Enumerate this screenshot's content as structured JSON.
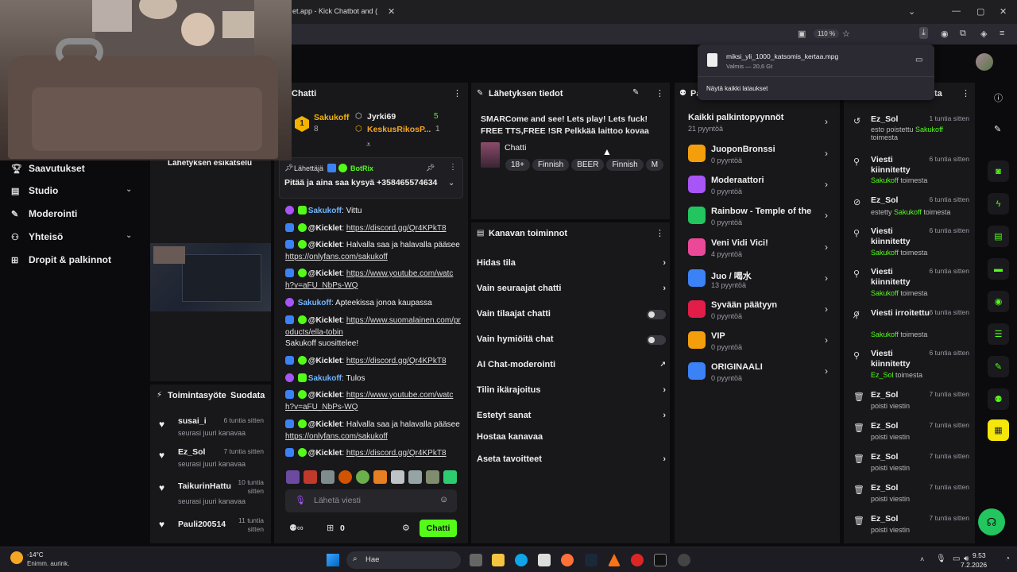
{
  "browser": {
    "tab_title": "et.app - Kick Chatbot and (",
    "zoom": "110 %",
    "download_file": "miksi_yli_1000_katsomis_kertaa.mpg",
    "download_status": "Valmis — 20,6 Gt",
    "download_show_all": "Näytä kaikki lataukset"
  },
  "sidebar": {
    "items": [
      {
        "label": "Saavutukset",
        "icon": "trophy-icon"
      },
      {
        "label": "Studio",
        "icon": "studio-icon"
      },
      {
        "label": "Moderointi",
        "icon": "wrench-icon"
      },
      {
        "label": "Yhteisö",
        "icon": "people-icon"
      },
      {
        "label": "Dropit & palkinnot",
        "icon": "gift-icon"
      }
    ],
    "preview_title": "Lähetyksen esikatselu"
  },
  "activity": {
    "title": "Toimintasyöte",
    "action": "Suodata",
    "rows": [
      {
        "name": "susai_i",
        "time": "6 tuntia sitten",
        "sub": "seurasi juuri kanavaa"
      },
      {
        "name": "Ez_Sol",
        "time": "7 tuntia sitten",
        "sub": "seurasi juuri kanavaa"
      },
      {
        "name": "TaikurinHattu",
        "time": "10 tuntia sitten",
        "sub": "seurasi juuri kanavaa"
      },
      {
        "name": "Pauli200514",
        "time": "11 tuntia sitten",
        "sub": "seurasi juuri kanavaa"
      }
    ]
  },
  "chat": {
    "title": "Chatti",
    "leader1_name": "Sakukoff",
    "leader1_count": "8",
    "leader2_name": "Jyrki69",
    "leader2_count": "5",
    "leader3_name": "KeskusRikosP...",
    "leader3_count": "1",
    "pinned_by_label": "Lähettäjä",
    "pinned_by": "BotRix",
    "pinned_text": "Pitää ja aina saa kysyä +358465574634",
    "messages": [
      {
        "user": "Sakukoff",
        "text": "Vittu"
      },
      {
        "user": "@Kicklet",
        "link": "https://discord.gg/Qr4KPkT8"
      },
      {
        "user": "@Kicklet",
        "text": "Halvalla saa ja halavalla pääsee",
        "link": "https://onlyfans.com/sakukoff"
      },
      {
        "user": "@Kicklet",
        "link": "https://www.youtube.com/watch?v=aFU_NbPs-WQ"
      },
      {
        "user": "Sakukoff",
        "text": "Apteekissa jonoa kaupassa"
      },
      {
        "user": "@Kicklet",
        "link": "https://www.suomalainen.com/products/ella-tobin",
        "text2": "Sakukoff suosittelee!"
      },
      {
        "user": "@Kicklet",
        "link": "https://discord.gg/Qr4KPkT8"
      },
      {
        "user": "Sakukoff",
        "text": "Tulos"
      },
      {
        "user": "@Kicklet",
        "link": "https://www.youtube.com/watch?v=aFU_NbPs-WQ"
      },
      {
        "user": "@Kicklet",
        "text": "Halvalla saa ja halavalla pääsee",
        "link": "https://onlyfans.com/sakukoff"
      },
      {
        "user": "@Kicklet",
        "link": "https://discord.gg/Qr4KPkT8"
      }
    ],
    "input_placeholder": "Lähetä viesti",
    "points": "0",
    "send_label": "Chatti"
  },
  "stream_info": {
    "title": "Lähetyksen tiedot",
    "stream_title": "SMARCome and see! Lets play! Lets fuck! FREE TTS,FREE !SR Pelkkää laittoo kovaa ajo...",
    "category": "Chatti",
    "tags": [
      "18+",
      "Finnish",
      "BEER",
      "Finnish",
      "M"
    ]
  },
  "channel_actions": {
    "title": "Kanavan toiminnot",
    "rows": [
      {
        "label": "Hidas tila",
        "kind": "chevron"
      },
      {
        "label": "Vain seuraajat chatti",
        "kind": "chevron"
      },
      {
        "label": "Vain tilaajat chatti",
        "kind": "toggle"
      },
      {
        "label": "Vain hymiöitä chat",
        "kind": "toggle"
      },
      {
        "label": "AI Chat-moderointi",
        "kind": "external"
      },
      {
        "label": "Tilin ikärajoitus",
        "kind": "chevron"
      },
      {
        "label": "Estetyt sanat",
        "kind": "chevron"
      },
      {
        "label": "Hostaa kanavaa",
        "kind": "none"
      },
      {
        "label": "Aseta tavoitteet",
        "kind": "chevron"
      }
    ]
  },
  "rewards": {
    "title": "Pa",
    "all_label": "Kaikki palkintopyynnöt",
    "all_count": "21 pyyntöä",
    "items": [
      {
        "name": "JuoponBronssi",
        "count": "0 pyyntöä",
        "color": "#f59e0b"
      },
      {
        "name": "Moderaattori",
        "count": "0 pyyntöä",
        "color": "#a855f7"
      },
      {
        "name": "Rainbow - Temple of the...",
        "count": "0 pyyntöä",
        "color": "#22c55e"
      },
      {
        "name": "Veni Vidi Vici!",
        "count": "4 pyyntöä",
        "color": "#ec4899"
      },
      {
        "name": "Juo / 喝水",
        "count": "13 pyyntöä",
        "color": "#3b82f6"
      },
      {
        "name": "Syvään päätyyn",
        "count": "0 pyyntöä",
        "color": "#e11d48"
      },
      {
        "name": "VIP",
        "count": "0 pyyntöä",
        "color": "#f59e0b"
      },
      {
        "name": "ORIGINAALI",
        "count": "0 pyyntöä",
        "color": "#3b82f6"
      }
    ]
  },
  "modlog": {
    "title": "ta",
    "rows": [
      {
        "icon": "undo-icon",
        "title": "Ez_Sol",
        "time": "1 tuntia sitten",
        "sub_pre": "esto poistettu ",
        "sub_user": "Sakukoff",
        "sub_post": " toimesta"
      },
      {
        "icon": "pin-icon",
        "title": "Viesti kiinnitetty",
        "time": "6 tuntia sitten",
        "sub_pre": "",
        "sub_user": "Sakukoff",
        "sub_post": " toimesta"
      },
      {
        "icon": "ban-icon",
        "title": "Ez_Sol",
        "time": "6 tuntia sitten",
        "sub_pre": "estetty ",
        "sub_user": "Sakukoff",
        "sub_post": " toimesta"
      },
      {
        "icon": "pin-icon",
        "title": "Viesti kiinnitetty",
        "time": "6 tuntia sitten",
        "sub_pre": "",
        "sub_user": "Sakukoff",
        "sub_post": " toimesta"
      },
      {
        "icon": "pin-icon",
        "title": "Viesti kiinnitetty",
        "time": "6 tuntia sitten",
        "sub_pre": "",
        "sub_user": "Sakukoff",
        "sub_post": " toimesta"
      },
      {
        "icon": "unpin-icon",
        "title": "Viesti irroitettu",
        "time": "6 tuntia sitten",
        "sub_pre": "",
        "sub_user": "Sakukoff",
        "sub_post": " toimesta"
      },
      {
        "icon": "pin-icon",
        "title": "Viesti kiinnitetty",
        "time": "6 tuntia sitten",
        "sub_pre": "",
        "sub_user": "Ez_Sol",
        "sub_post": " toimesta"
      },
      {
        "icon": "trash-icon",
        "title": "Ez_Sol",
        "time": "7 tuntia sitten",
        "sub_pre": "poisti viestin",
        "sub_user": "",
        "sub_post": ""
      },
      {
        "icon": "trash-icon",
        "title": "Ez_Sol",
        "time": "7 tuntia sitten",
        "sub_pre": "poisti viestin",
        "sub_user": "",
        "sub_post": ""
      },
      {
        "icon": "trash-icon",
        "title": "Ez_Sol",
        "time": "7 tuntia sitten",
        "sub_pre": "poisti viestin",
        "sub_user": "",
        "sub_post": ""
      },
      {
        "icon": "trash-icon",
        "title": "Ez_Sol",
        "time": "7 tuntia sitten",
        "sub_pre": "poisti viestin",
        "sub_user": "",
        "sub_post": ""
      },
      {
        "icon": "trash-icon",
        "title": "Ez_Sol",
        "time": "7 tuntia sitten",
        "sub_pre": "poisti viestin",
        "sub_user": "",
        "sub_post": ""
      }
    ]
  },
  "taskbar": {
    "weather_temp": "-14°C",
    "weather_desc": "Enimm. aurink.",
    "search": "Hae",
    "time": "9.53",
    "date": "7.2.2026"
  },
  "colors": {
    "accent": "#53fc18",
    "panel": "#18181b",
    "bg": "#0b0b0d"
  }
}
